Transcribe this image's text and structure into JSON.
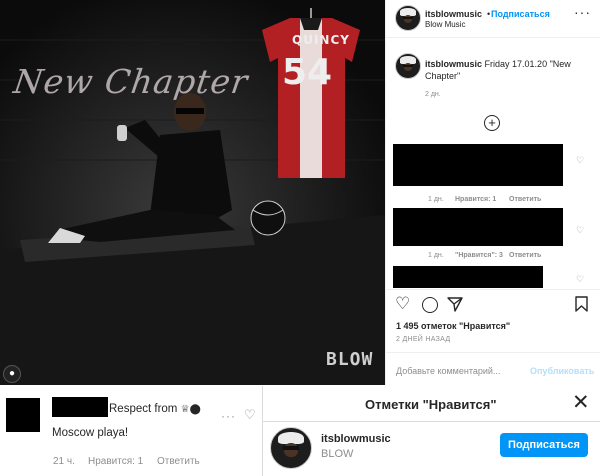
{
  "post": {
    "photo": {
      "title_script": "New Chapter",
      "jersey_name": "QUINCY",
      "jersey_number": "54",
      "brand_mark": "BLOW"
    },
    "header": {
      "username": "itsblowmusic",
      "separator": "•",
      "follow_label": "Подписаться",
      "subtitle": "Blow Music",
      "more_icon": "more-horizontal-icon"
    },
    "caption": {
      "username": "itsblowmusic",
      "text": "Friday 17.01.20 \"New Chapter\"",
      "time": "2 дн."
    },
    "comments": [
      {
        "time": "1 дн.",
        "likes": "Нравится: 1",
        "reply": "Ответить"
      },
      {
        "time": "1 дн.",
        "likes": "\"Нравится\": 3",
        "reply": "Ответить"
      }
    ],
    "likes_count": "1 495 отметок \"Нравится\"",
    "posted_ago": "2 ДНЕЙ НАЗАД",
    "add_comment_placeholder": "Добавьте комментарий...",
    "publish_label": "Опубликовать"
  },
  "bottom_comment": {
    "text_suffix": "Respect from",
    "second_line": "Moscow playa!",
    "time": "21 ч.",
    "likes": "Нравится: 1",
    "reply": "Ответить",
    "more_icon": "more-horizontal-icon"
  },
  "likes_modal": {
    "title": "Отметки \"Нравится\"",
    "user": {
      "username": "itsblowmusic",
      "name": "BLOW",
      "follow_label": "Подписаться"
    }
  },
  "colors": {
    "accent": "#0095f6",
    "text": "#262626",
    "muted": "#8e8e8e",
    "photo_bg": "#121212",
    "jersey_red": "#b22024"
  }
}
